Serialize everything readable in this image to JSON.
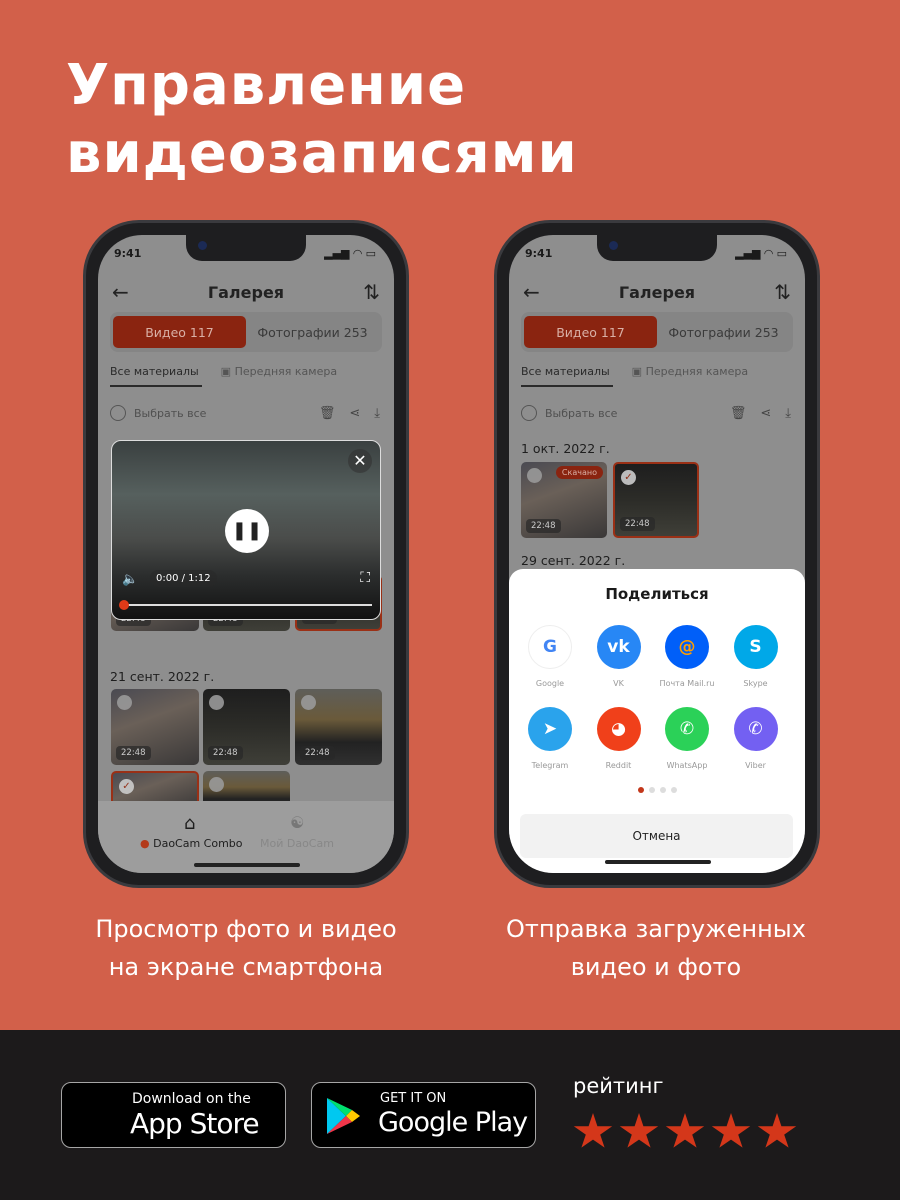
{
  "headline": {
    "line1": "Управление",
    "line2": "видеозаписями"
  },
  "captions": {
    "left_line1": "Просмотр фото и видео",
    "left_line2": "на экране смартфона",
    "right_line1": "Отправка загруженных",
    "right_line2": "видео и фото"
  },
  "phone": {
    "time": "9:41",
    "title": "Галерея",
    "seg_video": "Видео 117",
    "seg_photo": "Фотографии 253",
    "tab_all": "Все материалы",
    "tab_front": "Передняя камера",
    "select_all": "Выбрать все"
  },
  "left": {
    "date2": "21 сент. 2022 г.",
    "thumb_time": "22:48",
    "player_time": "0:00 / 1:12",
    "player_progress": 0.0,
    "nav_home": "DaoCam Combo",
    "nav_my": "Мой DaoCam"
  },
  "right": {
    "date1": "1 окт. 2022 г.",
    "date2": "29 сент. 2022 г.",
    "downloaded_badge": "Скачано",
    "thumb_time": "22:48",
    "share_title": "Поделиться",
    "apps": [
      {
        "label": "Google",
        "color": "#ffffff"
      },
      {
        "label": "VK",
        "color": "#2787F5"
      },
      {
        "label": "Почта Mail.ru",
        "color": "#005FF9"
      },
      {
        "label": "Skype",
        "color": "#00A8E8"
      },
      {
        "label": "Telegram",
        "color": "#2AA3EC"
      },
      {
        "label": "Reddit",
        "color": "#F0401A"
      },
      {
        "label": "WhatsApp",
        "color": "#2BD158"
      },
      {
        "label": "Viber",
        "color": "#7360F2"
      }
    ],
    "page_dots": 4,
    "active_dot": 1,
    "cancel": "Отмена"
  },
  "stores": {
    "apple_small": "Download on the",
    "apple_big": "App Store",
    "google_small": "GET IT ON",
    "google_big": "Google Play"
  },
  "rating": {
    "label": "рейтинг",
    "stars": 4.8,
    "star_color": "#D4371A"
  },
  "colors": {
    "background": "#D2604A",
    "accent": "#C3371A",
    "band": "#1C1A1B"
  }
}
